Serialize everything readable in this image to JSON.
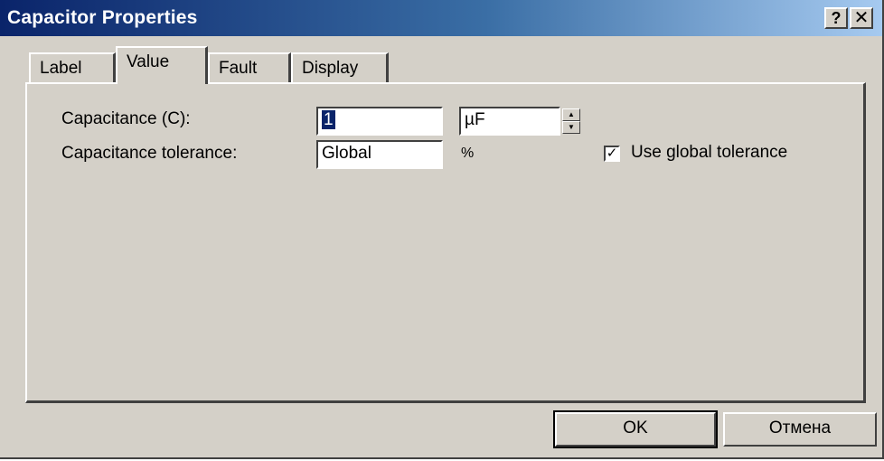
{
  "window": {
    "title": "Capacitor Properties",
    "help_button": "?",
    "close_button": "✕"
  },
  "tabs": [
    {
      "label": "Label",
      "active": false
    },
    {
      "label": "Value",
      "active": true
    },
    {
      "label": "Fault",
      "active": false
    },
    {
      "label": "Display",
      "active": false
    }
  ],
  "value_page": {
    "capacitance_label": "Capacitance (C):",
    "capacitance_value": "1",
    "unit_value": "µF",
    "tolerance_label": "Capacitance tolerance:",
    "tolerance_value": "Global",
    "tolerance_unit": "%",
    "use_global_tolerance_label": "Use global tolerance",
    "use_global_tolerance_checked": true,
    "check_mark": "✓"
  },
  "buttons": {
    "ok": "OK",
    "cancel": "Отмена"
  },
  "colors": {
    "titlebar_start": "#0a246a",
    "titlebar_end": "#a6caf0",
    "face": "#d4d0c8",
    "selection": "#0a246a"
  }
}
